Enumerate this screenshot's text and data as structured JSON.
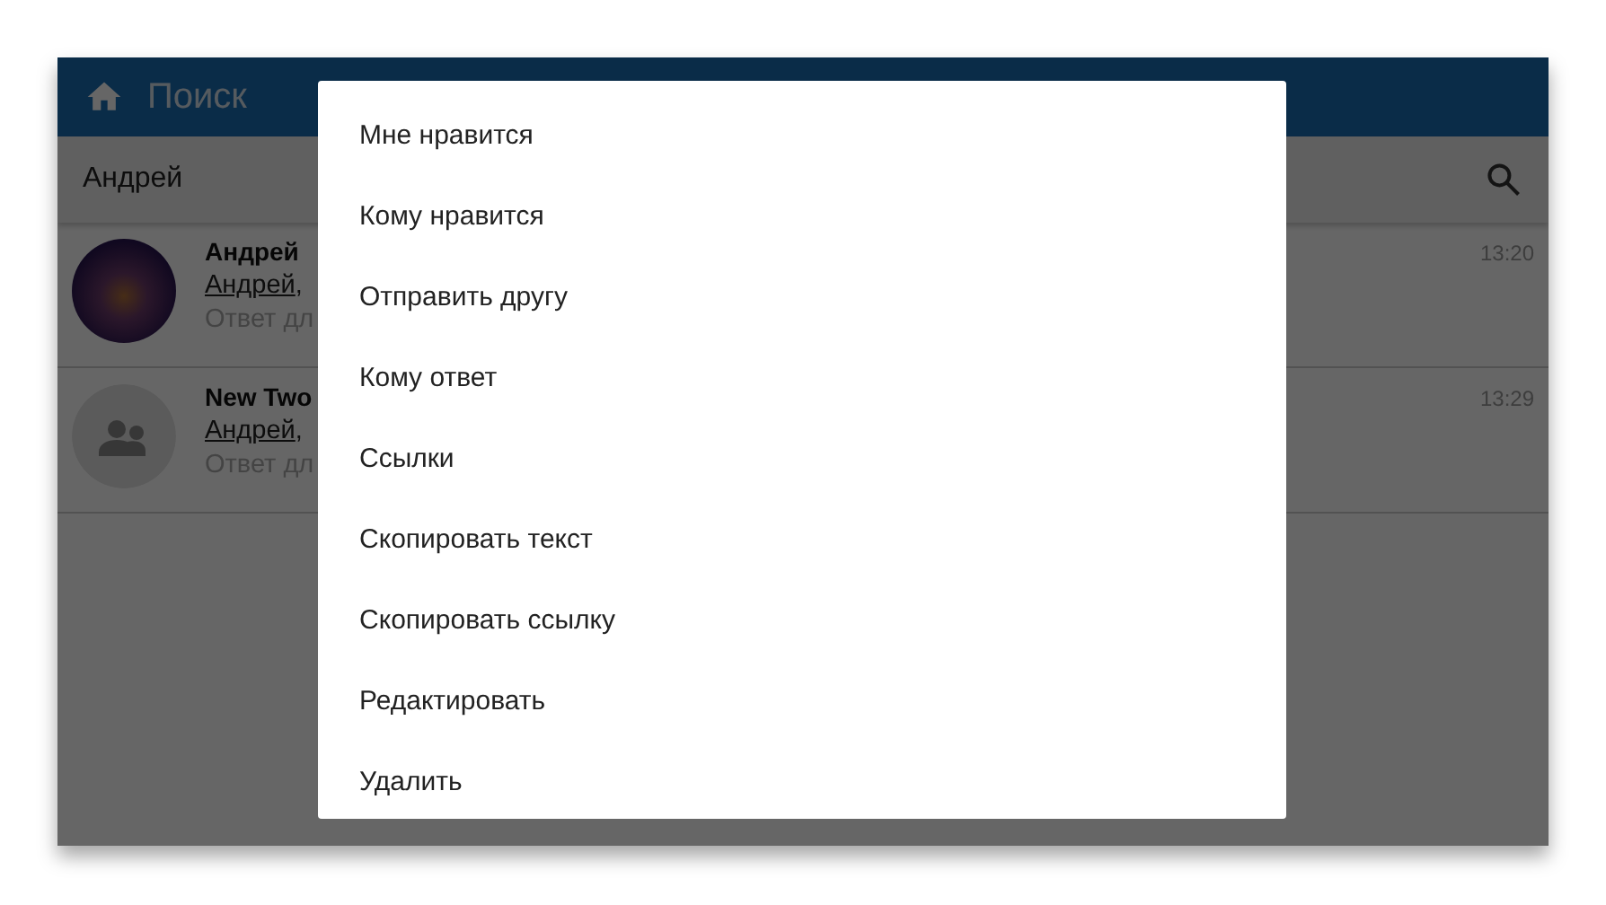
{
  "app_bar": {
    "title": "Поиск"
  },
  "search": {
    "value": "Андрей"
  },
  "conversations": [
    {
      "kind": "photo",
      "title": "Андрей",
      "author": "Андрей",
      "preview_rest": ",",
      "snippet": "Ответ дл",
      "time": "13:20"
    },
    {
      "kind": "group",
      "title": "New Two",
      "author": "Андрей",
      "preview_rest": ",",
      "snippet": "Ответ дл",
      "time": "13:29"
    }
  ],
  "menu": {
    "items": [
      "Мне нравится",
      "Кому нравится",
      "Отправить другу",
      "Кому ответ",
      "Ссылки",
      "Скопировать текст",
      "Скопировать ссылку",
      "Редактировать",
      "Удалить"
    ]
  }
}
